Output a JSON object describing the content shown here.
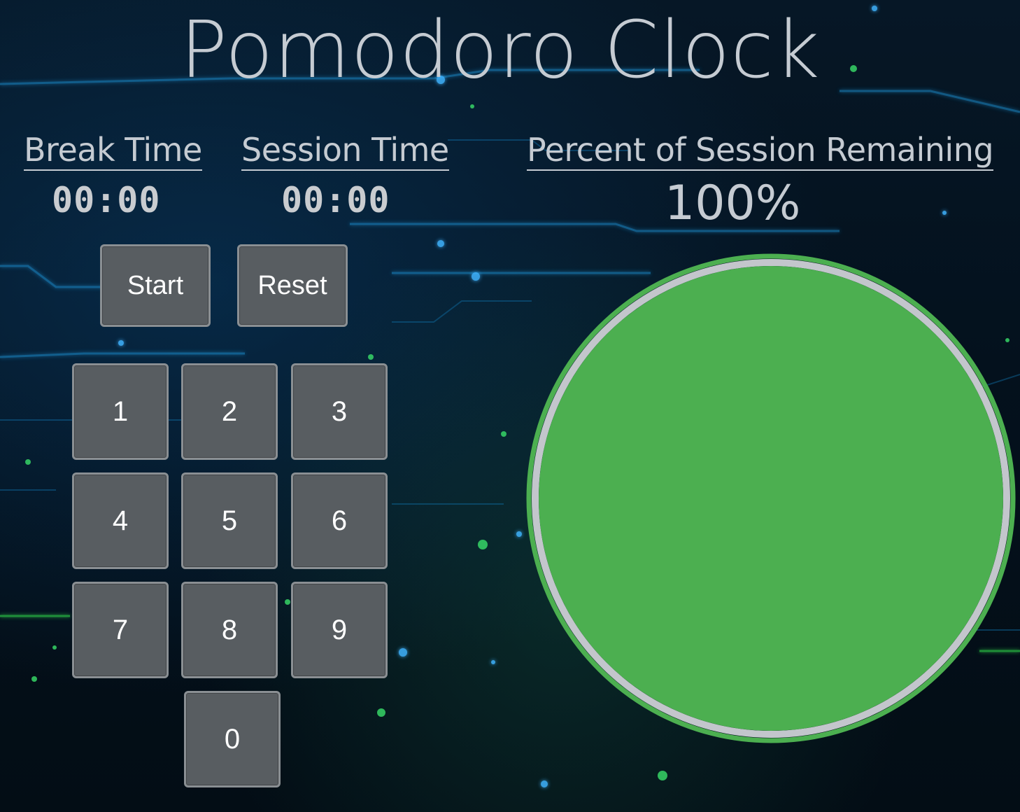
{
  "app": {
    "title": "Pomodoro Clock"
  },
  "break": {
    "label": "Break Time",
    "value": "00:00"
  },
  "session": {
    "label": "Session Time",
    "value": "00:00"
  },
  "percent": {
    "label": "Percent of Session Remaining",
    "value_text": "100%",
    "remaining_fraction": 1.0
  },
  "controls": {
    "start_label": "Start",
    "reset_label": "Reset"
  },
  "keypad": {
    "keys": [
      "1",
      "2",
      "3",
      "4",
      "5",
      "6",
      "7",
      "8",
      "9",
      "0"
    ]
  },
  "colors": {
    "progress_fill": "#4caf50",
    "progress_ring": "#c3c6cc",
    "button_bg": "#585d61",
    "text": "#c5cbd2"
  }
}
